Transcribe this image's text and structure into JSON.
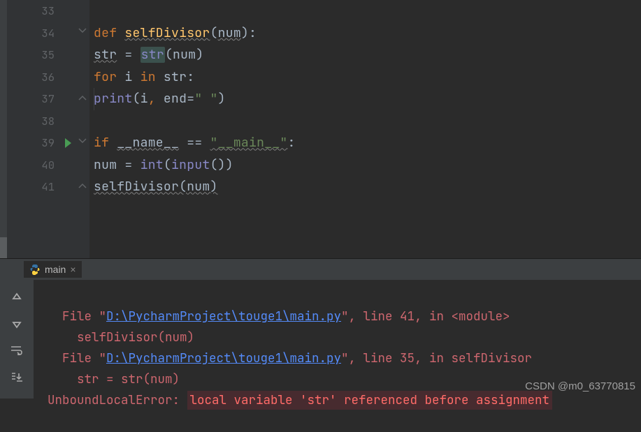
{
  "editor": {
    "lines": [
      {
        "num": 33
      },
      {
        "num": 34
      },
      {
        "num": 35
      },
      {
        "num": 36
      },
      {
        "num": 37
      },
      {
        "num": 38
      },
      {
        "num": 39,
        "run": true
      },
      {
        "num": 40
      },
      {
        "num": 41
      }
    ],
    "code": {
      "l34": {
        "kw_def": "def ",
        "fn": "selfDivisor",
        "paren_open": "(",
        "param": "num",
        "paren_close": "):"
      },
      "l35": {
        "lhs": "str",
        "eq": " = ",
        "builtin": "str",
        "call": "(num)"
      },
      "l36": {
        "kw_for": "for ",
        "var": "i",
        "kw_in": " in ",
        "iter": "str:"
      },
      "l37": {
        "fn": "print",
        "open": "(",
        "arg1": "i",
        "comma": ", ",
        "kw_end": "end",
        "eq": "=",
        "str": "\" \"",
        "close": ")"
      },
      "l39": {
        "kw_if": "if ",
        "name": "__name__",
        "eq": " == ",
        "str": "\"__main__\"",
        "colon": ":"
      },
      "l40": {
        "lhs": "num = ",
        "builtin": "int",
        "open": "(",
        "builtin2": "input",
        "call": "())"
      },
      "l41": {
        "fn": "selfDivisor(num)"
      }
    }
  },
  "tab": {
    "name": "main"
  },
  "console": {
    "l1_pre": "  File \"",
    "l1_path": "D:\\PycharmProject\\touge1\\main.py",
    "l1_post": "\", line 41, in <module>",
    "l2": "    selfDivisor(num)",
    "l3_pre": "  File \"",
    "l3_path": "D:\\PycharmProject\\touge1\\main.py",
    "l3_post": "\", line 35, in selfDivisor",
    "l4": "    str = str(num)",
    "l5_err": "UnboundLocalError",
    "l5_colon": ": ",
    "l5_msg": "local variable 'str' referenced before assignment"
  },
  "watermark": "CSDN @m0_63770815"
}
